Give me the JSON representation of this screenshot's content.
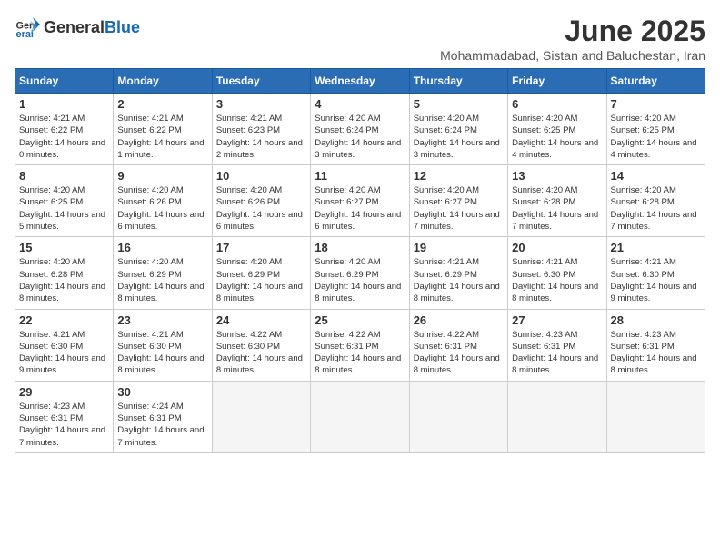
{
  "header": {
    "logo_general": "General",
    "logo_blue": "Blue",
    "month_title": "June 2025",
    "subtitle": "Mohammadabad, Sistan and Baluchestan, Iran"
  },
  "days_of_week": [
    "Sunday",
    "Monday",
    "Tuesday",
    "Wednesday",
    "Thursday",
    "Friday",
    "Saturday"
  ],
  "weeks": [
    [
      {
        "day": "1",
        "sunrise": "4:21 AM",
        "sunset": "6:22 PM",
        "daylight": "14 hours and 0 minutes."
      },
      {
        "day": "2",
        "sunrise": "4:21 AM",
        "sunset": "6:22 PM",
        "daylight": "14 hours and 1 minute."
      },
      {
        "day": "3",
        "sunrise": "4:21 AM",
        "sunset": "6:23 PM",
        "daylight": "14 hours and 2 minutes."
      },
      {
        "day": "4",
        "sunrise": "4:20 AM",
        "sunset": "6:24 PM",
        "daylight": "14 hours and 3 minutes."
      },
      {
        "day": "5",
        "sunrise": "4:20 AM",
        "sunset": "6:24 PM",
        "daylight": "14 hours and 3 minutes."
      },
      {
        "day": "6",
        "sunrise": "4:20 AM",
        "sunset": "6:25 PM",
        "daylight": "14 hours and 4 minutes."
      },
      {
        "day": "7",
        "sunrise": "4:20 AM",
        "sunset": "6:25 PM",
        "daylight": "14 hours and 4 minutes."
      }
    ],
    [
      {
        "day": "8",
        "sunrise": "4:20 AM",
        "sunset": "6:25 PM",
        "daylight": "14 hours and 5 minutes."
      },
      {
        "day": "9",
        "sunrise": "4:20 AM",
        "sunset": "6:26 PM",
        "daylight": "14 hours and 6 minutes."
      },
      {
        "day": "10",
        "sunrise": "4:20 AM",
        "sunset": "6:26 PM",
        "daylight": "14 hours and 6 minutes."
      },
      {
        "day": "11",
        "sunrise": "4:20 AM",
        "sunset": "6:27 PM",
        "daylight": "14 hours and 6 minutes."
      },
      {
        "day": "12",
        "sunrise": "4:20 AM",
        "sunset": "6:27 PM",
        "daylight": "14 hours and 7 minutes."
      },
      {
        "day": "13",
        "sunrise": "4:20 AM",
        "sunset": "6:28 PM",
        "daylight": "14 hours and 7 minutes."
      },
      {
        "day": "14",
        "sunrise": "4:20 AM",
        "sunset": "6:28 PM",
        "daylight": "14 hours and 7 minutes."
      }
    ],
    [
      {
        "day": "15",
        "sunrise": "4:20 AM",
        "sunset": "6:28 PM",
        "daylight": "14 hours and 8 minutes."
      },
      {
        "day": "16",
        "sunrise": "4:20 AM",
        "sunset": "6:29 PM",
        "daylight": "14 hours and 8 minutes."
      },
      {
        "day": "17",
        "sunrise": "4:20 AM",
        "sunset": "6:29 PM",
        "daylight": "14 hours and 8 minutes."
      },
      {
        "day": "18",
        "sunrise": "4:20 AM",
        "sunset": "6:29 PM",
        "daylight": "14 hours and 8 minutes."
      },
      {
        "day": "19",
        "sunrise": "4:21 AM",
        "sunset": "6:29 PM",
        "daylight": "14 hours and 8 minutes."
      },
      {
        "day": "20",
        "sunrise": "4:21 AM",
        "sunset": "6:30 PM",
        "daylight": "14 hours and 8 minutes."
      },
      {
        "day": "21",
        "sunrise": "4:21 AM",
        "sunset": "6:30 PM",
        "daylight": "14 hours and 9 minutes."
      }
    ],
    [
      {
        "day": "22",
        "sunrise": "4:21 AM",
        "sunset": "6:30 PM",
        "daylight": "14 hours and 9 minutes."
      },
      {
        "day": "23",
        "sunrise": "4:21 AM",
        "sunset": "6:30 PM",
        "daylight": "14 hours and 8 minutes."
      },
      {
        "day": "24",
        "sunrise": "4:22 AM",
        "sunset": "6:30 PM",
        "daylight": "14 hours and 8 minutes."
      },
      {
        "day": "25",
        "sunrise": "4:22 AM",
        "sunset": "6:31 PM",
        "daylight": "14 hours and 8 minutes."
      },
      {
        "day": "26",
        "sunrise": "4:22 AM",
        "sunset": "6:31 PM",
        "daylight": "14 hours and 8 minutes."
      },
      {
        "day": "27",
        "sunrise": "4:23 AM",
        "sunset": "6:31 PM",
        "daylight": "14 hours and 8 minutes."
      },
      {
        "day": "28",
        "sunrise": "4:23 AM",
        "sunset": "6:31 PM",
        "daylight": "14 hours and 8 minutes."
      }
    ],
    [
      {
        "day": "29",
        "sunrise": "4:23 AM",
        "sunset": "6:31 PM",
        "daylight": "14 hours and 7 minutes."
      },
      {
        "day": "30",
        "sunrise": "4:24 AM",
        "sunset": "6:31 PM",
        "daylight": "14 hours and 7 minutes."
      },
      null,
      null,
      null,
      null,
      null
    ]
  ]
}
